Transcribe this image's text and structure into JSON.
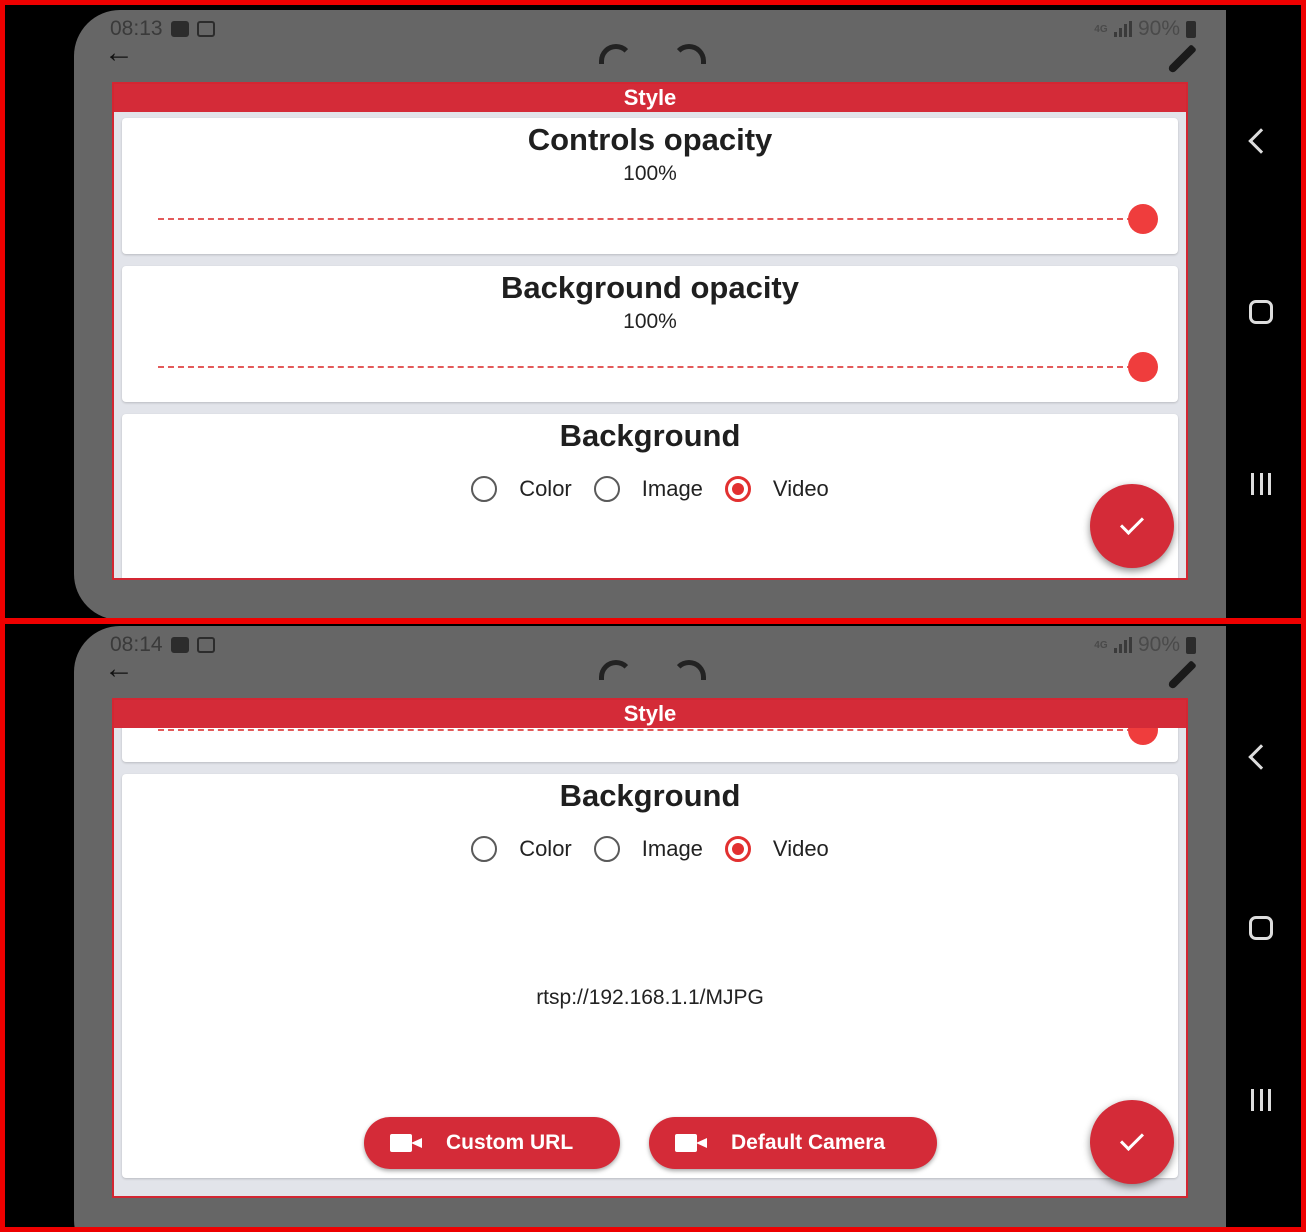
{
  "screens": [
    {
      "status": {
        "time": "08:13",
        "network": "4G",
        "battery": "90%"
      },
      "dialog_title": "Style",
      "controls_opacity": {
        "title": "Controls opacity",
        "value": "100%",
        "level": 1.0
      },
      "background_opacity": {
        "title": "Background opacity",
        "value": "100%",
        "level": 1.0
      },
      "background": {
        "title": "Background",
        "options": [
          {
            "label": "Color",
            "checked": false
          },
          {
            "label": "Image",
            "checked": false
          },
          {
            "label": "Video",
            "checked": true
          }
        ]
      }
    },
    {
      "status": {
        "time": "08:14",
        "network": "4G",
        "battery": "90%"
      },
      "dialog_title": "Style",
      "background": {
        "title": "Background",
        "options": [
          {
            "label": "Color",
            "checked": false
          },
          {
            "label": "Image",
            "checked": false
          },
          {
            "label": "Video",
            "checked": true
          }
        ],
        "video_url": "rtsp://192.168.1.1/MJPG",
        "buttons": {
          "custom_url": "Custom URL",
          "default_camera": "Default Camera"
        }
      }
    }
  ],
  "icons": {
    "back": "back-arrow-icon",
    "undo": "undo-icon",
    "redo": "redo-icon",
    "brush": "brush-icon",
    "fab": "check-icon",
    "camera": "videocam-icon",
    "nav": [
      "nav-back-icon",
      "nav-home-icon",
      "nav-recents-icon"
    ]
  },
  "colors": {
    "accent": "#d42b38",
    "slider": "#ef3d3d",
    "overlay": "#666666"
  }
}
